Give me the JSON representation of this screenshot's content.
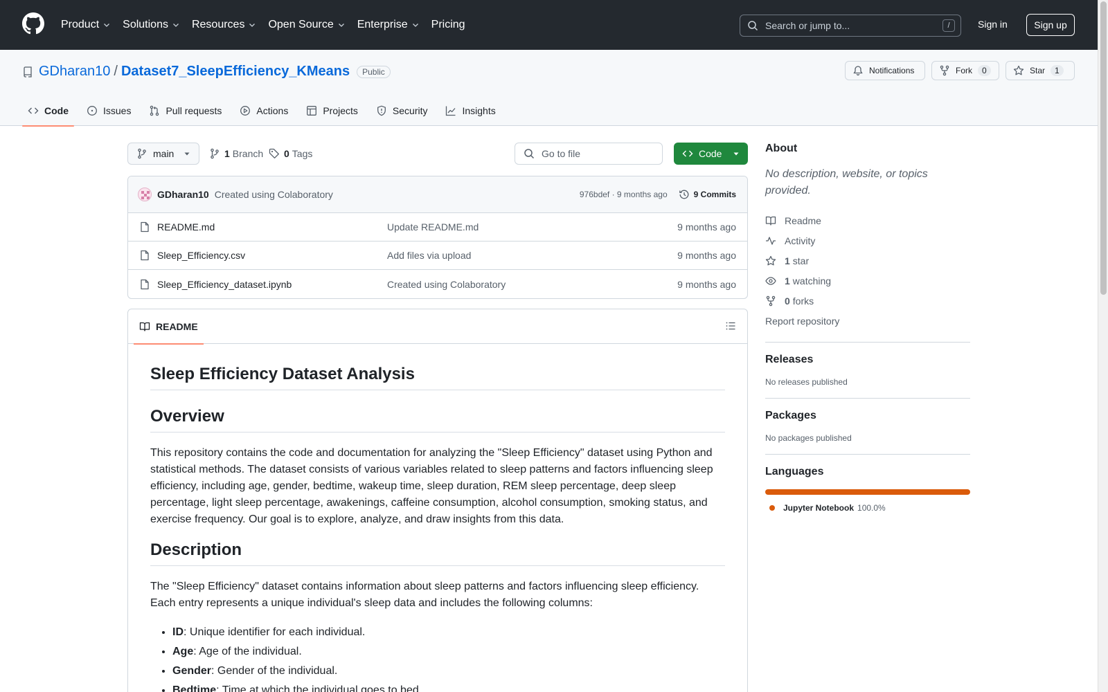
{
  "header": {
    "nav": [
      {
        "label": "Product",
        "has_menu": true
      },
      {
        "label": "Solutions",
        "has_menu": true
      },
      {
        "label": "Resources",
        "has_menu": true
      },
      {
        "label": "Open Source",
        "has_menu": true
      },
      {
        "label": "Enterprise",
        "has_menu": true
      },
      {
        "label": "Pricing",
        "has_menu": false
      }
    ],
    "search_placeholder": "Search or jump to...",
    "search_shortcut": "/",
    "sign_in": "Sign in",
    "sign_up": "Sign up"
  },
  "repo": {
    "owner": "GDharan10",
    "separator": "/",
    "name": "Dataset7_SleepEfficiency_KMeans",
    "visibility": "Public",
    "notifications_label": "Notifications",
    "fork_label": "Fork",
    "fork_count": "0",
    "star_label": "Star",
    "star_count": "1"
  },
  "tabs": [
    {
      "label": "Code",
      "icon": "code-icon",
      "active": true
    },
    {
      "label": "Issues",
      "icon": "issue-icon",
      "active": false
    },
    {
      "label": "Pull requests",
      "icon": "pull-request-icon",
      "active": false
    },
    {
      "label": "Actions",
      "icon": "play-icon",
      "active": false
    },
    {
      "label": "Projects",
      "icon": "table-icon",
      "active": false
    },
    {
      "label": "Security",
      "icon": "shield-icon",
      "active": false
    },
    {
      "label": "Insights",
      "icon": "graph-icon",
      "active": false
    }
  ],
  "filebar": {
    "branch": "main",
    "branch_count": "1",
    "branch_label": "Branch",
    "tag_count": "0",
    "tag_label": "Tags",
    "go_to_file_placeholder": "Go to file",
    "code_button": "Code"
  },
  "commit": {
    "author": "GDharan10",
    "message": "Created using Colaboratory",
    "hash_time": "976bdef · 9 months ago",
    "commits_label": "9 Commits"
  },
  "files": [
    {
      "name": "README.md",
      "message": "Update README.md",
      "date": "9 months ago"
    },
    {
      "name": "Sleep_Efficiency.csv",
      "message": "Add files via upload",
      "date": "9 months ago"
    },
    {
      "name": "Sleep_Efficiency_dataset.ipynb",
      "message": "Created using Colaboratory",
      "date": "9 months ago"
    }
  ],
  "readme": {
    "tab_label": "README",
    "title": "Sleep Efficiency Dataset Analysis",
    "overview_heading": "Overview",
    "overview_text": "This repository contains the code and documentation for analyzing the \"Sleep Efficiency\" dataset using Python and statistical methods. The dataset consists of various variables related to sleep patterns and factors influencing sleep efficiency, including age, gender, bedtime, wakeup time, sleep duration, REM sleep percentage, deep sleep percentage, light sleep percentage, awakenings, caffeine consumption, alcohol consumption, smoking status, and exercise frequency. Our goal is to explore, analyze, and draw insights from this data.",
    "description_heading": "Description",
    "description_text": "The \"Sleep Efficiency\" dataset contains information about sleep patterns and factors influencing sleep efficiency. Each entry represents a unique individual's sleep data and includes the following columns:",
    "columns": [
      {
        "term": "ID",
        "desc": ": Unique identifier for each individual."
      },
      {
        "term": "Age",
        "desc": ": Age of the individual."
      },
      {
        "term": "Gender",
        "desc": ": Gender of the individual."
      },
      {
        "term": "Bedtime",
        "desc": ": Time at which the individual goes to bed."
      }
    ]
  },
  "sidebar": {
    "about_heading": "About",
    "about_desc": "No description, website, or topics provided.",
    "readme": "Readme",
    "activity": "Activity",
    "stars_count": "1",
    "stars_label": "star",
    "watching_count": "1",
    "watching_label": "watching",
    "forks_count": "0",
    "forks_label": "forks",
    "report": "Report repository",
    "releases_heading": "Releases",
    "releases_text": "No releases published",
    "packages_heading": "Packages",
    "packages_text": "No packages published",
    "languages_heading": "Languages",
    "language_name": "Jupyter Notebook",
    "language_pct": "100.0%",
    "language_color": "#da5b0b"
  }
}
